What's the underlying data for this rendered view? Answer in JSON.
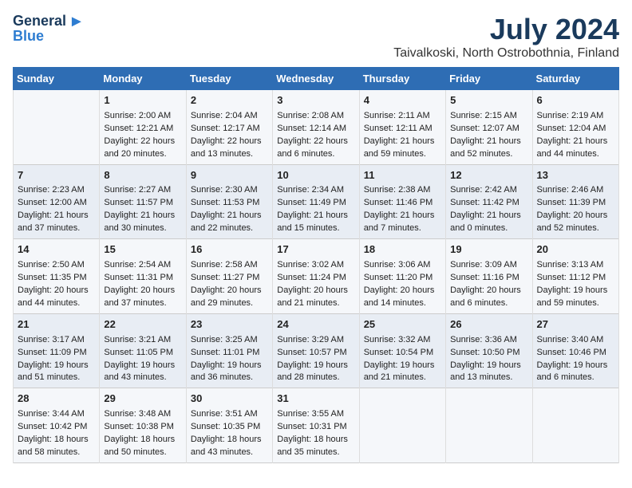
{
  "header": {
    "logo_general": "General",
    "logo_blue": "Blue",
    "title": "July 2024",
    "subtitle": "Taivalkoski, North Ostrobothnia, Finland"
  },
  "calendar": {
    "days_of_week": [
      "Sunday",
      "Monday",
      "Tuesday",
      "Wednesday",
      "Thursday",
      "Friday",
      "Saturday"
    ],
    "weeks": [
      [
        {
          "day": "",
          "content": ""
        },
        {
          "day": "1",
          "content": "Sunrise: 2:00 AM\nSunset: 12:21 AM\nDaylight: 22 hours\nand 20 minutes."
        },
        {
          "day": "2",
          "content": "Sunrise: 2:04 AM\nSunset: 12:17 AM\nDaylight: 22 hours\nand 13 minutes."
        },
        {
          "day": "3",
          "content": "Sunrise: 2:08 AM\nSunset: 12:14 AM\nDaylight: 22 hours\nand 6 minutes."
        },
        {
          "day": "4",
          "content": "Sunrise: 2:11 AM\nSunset: 12:11 AM\nDaylight: 21 hours\nand 59 minutes."
        },
        {
          "day": "5",
          "content": "Sunrise: 2:15 AM\nSunset: 12:07 AM\nDaylight: 21 hours\nand 52 minutes."
        },
        {
          "day": "6",
          "content": "Sunrise: 2:19 AM\nSunset: 12:04 AM\nDaylight: 21 hours\nand 44 minutes."
        }
      ],
      [
        {
          "day": "7",
          "content": "Sunrise: 2:23 AM\nSunset: 12:00 AM\nDaylight: 21 hours\nand 37 minutes."
        },
        {
          "day": "8",
          "content": "Sunrise: 2:27 AM\nSunset: 11:57 PM\nDaylight: 21 hours\nand 30 minutes."
        },
        {
          "day": "9",
          "content": "Sunrise: 2:30 AM\nSunset: 11:53 PM\nDaylight: 21 hours\nand 22 minutes."
        },
        {
          "day": "10",
          "content": "Sunrise: 2:34 AM\nSunset: 11:49 PM\nDaylight: 21 hours\nand 15 minutes."
        },
        {
          "day": "11",
          "content": "Sunrise: 2:38 AM\nSunset: 11:46 PM\nDaylight: 21 hours\nand 7 minutes."
        },
        {
          "day": "12",
          "content": "Sunrise: 2:42 AM\nSunset: 11:42 PM\nDaylight: 21 hours\nand 0 minutes."
        },
        {
          "day": "13",
          "content": "Sunrise: 2:46 AM\nSunset: 11:39 PM\nDaylight: 20 hours\nand 52 minutes."
        }
      ],
      [
        {
          "day": "14",
          "content": "Sunrise: 2:50 AM\nSunset: 11:35 PM\nDaylight: 20 hours\nand 44 minutes."
        },
        {
          "day": "15",
          "content": "Sunrise: 2:54 AM\nSunset: 11:31 PM\nDaylight: 20 hours\nand 37 minutes."
        },
        {
          "day": "16",
          "content": "Sunrise: 2:58 AM\nSunset: 11:27 PM\nDaylight: 20 hours\nand 29 minutes."
        },
        {
          "day": "17",
          "content": "Sunrise: 3:02 AM\nSunset: 11:24 PM\nDaylight: 20 hours\nand 21 minutes."
        },
        {
          "day": "18",
          "content": "Sunrise: 3:06 AM\nSunset: 11:20 PM\nDaylight: 20 hours\nand 14 minutes."
        },
        {
          "day": "19",
          "content": "Sunrise: 3:09 AM\nSunset: 11:16 PM\nDaylight: 20 hours\nand 6 minutes."
        },
        {
          "day": "20",
          "content": "Sunrise: 3:13 AM\nSunset: 11:12 PM\nDaylight: 19 hours\nand 59 minutes."
        }
      ],
      [
        {
          "day": "21",
          "content": "Sunrise: 3:17 AM\nSunset: 11:09 PM\nDaylight: 19 hours\nand 51 minutes."
        },
        {
          "day": "22",
          "content": "Sunrise: 3:21 AM\nSunset: 11:05 PM\nDaylight: 19 hours\nand 43 minutes."
        },
        {
          "day": "23",
          "content": "Sunrise: 3:25 AM\nSunset: 11:01 PM\nDaylight: 19 hours\nand 36 minutes."
        },
        {
          "day": "24",
          "content": "Sunrise: 3:29 AM\nSunset: 10:57 PM\nDaylight: 19 hours\nand 28 minutes."
        },
        {
          "day": "25",
          "content": "Sunrise: 3:32 AM\nSunset: 10:54 PM\nDaylight: 19 hours\nand 21 minutes."
        },
        {
          "day": "26",
          "content": "Sunrise: 3:36 AM\nSunset: 10:50 PM\nDaylight: 19 hours\nand 13 minutes."
        },
        {
          "day": "27",
          "content": "Sunrise: 3:40 AM\nSunset: 10:46 PM\nDaylight: 19 hours\nand 6 minutes."
        }
      ],
      [
        {
          "day": "28",
          "content": "Sunrise: 3:44 AM\nSunset: 10:42 PM\nDaylight: 18 hours\nand 58 minutes."
        },
        {
          "day": "29",
          "content": "Sunrise: 3:48 AM\nSunset: 10:38 PM\nDaylight: 18 hours\nand 50 minutes."
        },
        {
          "day": "30",
          "content": "Sunrise: 3:51 AM\nSunset: 10:35 PM\nDaylight: 18 hours\nand 43 minutes."
        },
        {
          "day": "31",
          "content": "Sunrise: 3:55 AM\nSunset: 10:31 PM\nDaylight: 18 hours\nand 35 minutes."
        },
        {
          "day": "",
          "content": ""
        },
        {
          "day": "",
          "content": ""
        },
        {
          "day": "",
          "content": ""
        }
      ]
    ]
  }
}
